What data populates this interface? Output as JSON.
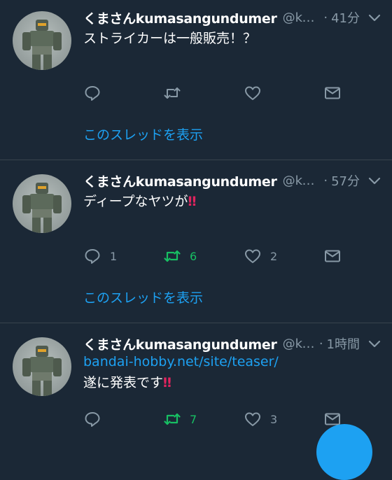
{
  "colors": {
    "background": "#1b2836",
    "link": "#1da1f2",
    "retweet_active": "#17bf63",
    "muted": "#8899a6"
  },
  "tweets": [
    {
      "name": "くまさんkumasangundumer",
      "handle": "@kunk...",
      "time": "41分",
      "lines": [
        "ストライカーは一般販売！？"
      ],
      "reply_count": "",
      "retweet_count": "",
      "like_count": "",
      "retweet_active": false,
      "thread_link": "このスレッドを表示"
    },
    {
      "name": "くまさんkumasangundumer",
      "handle": "@kunk...",
      "time": "57分",
      "lines": [
        "ディープなヤツが"
      ],
      "emoji": "‼",
      "reply_count": "1",
      "retweet_count": "6",
      "like_count": "2",
      "retweet_active": true,
      "thread_link": "このスレッドを表示"
    },
    {
      "name": "くまさんkumasangundumer",
      "handle": "@kun...",
      "time": "1時間",
      "link": "bandai-hobby.net/site/teaser/",
      "lines": [
        "遂に発表です"
      ],
      "emoji": "‼",
      "reply_count": "",
      "retweet_count": "7",
      "like_count": "3",
      "retweet_active": true
    }
  ],
  "icons": {
    "caret": "chevron-down-icon",
    "reply": "reply-icon",
    "retweet": "retweet-icon",
    "like": "heart-icon",
    "dm": "envelope-icon",
    "compose": "compose-fab"
  }
}
